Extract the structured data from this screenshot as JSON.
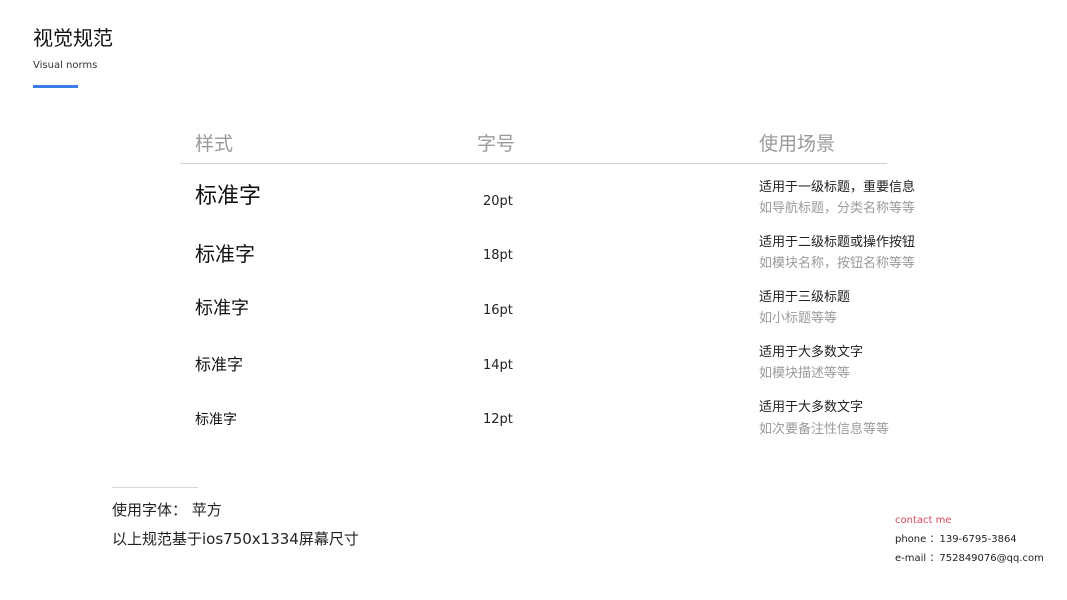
{
  "header": {
    "title": "视觉规范",
    "subtitle": "Visual norms"
  },
  "table": {
    "columns": [
      "样式",
      "字号",
      "使用场景"
    ],
    "rows": [
      {
        "sample": "标准字",
        "size": "20pt",
        "primary": "适用于一级标题，重要信息",
        "secondary": "如导航标题，分类名称等等"
      },
      {
        "sample": "标准字",
        "size": "18pt",
        "primary": "适用于二级标题或操作按钮",
        "secondary": "如模块名称，按钮名称等等"
      },
      {
        "sample": "标准字",
        "size": "16pt",
        "primary": "适用于三级标题",
        "secondary": "如小标题等等"
      },
      {
        "sample": "标准字",
        "size": "14pt",
        "primary": "适用于大多数文字",
        "secondary": "如模块描述等等"
      },
      {
        "sample": "标准字",
        "size": "12pt",
        "primary": "适用于大多数文字",
        "secondary": "如次要备注性信息等等"
      }
    ]
  },
  "footer": {
    "font_note": "使用字体：  苹方",
    "basis_note": "以上规范基于ios750x1334屏幕尺寸"
  },
  "contact": {
    "title": "contact me",
    "phone": "phone   ：139-6795-3864",
    "email": "e-mail  ：752849076@qq.com"
  },
  "colors": {
    "accent": "#3a7de8",
    "header_text": "#9a9a9a",
    "secondary_text": "#9b9b9b",
    "contact_title": "#e0485f"
  }
}
